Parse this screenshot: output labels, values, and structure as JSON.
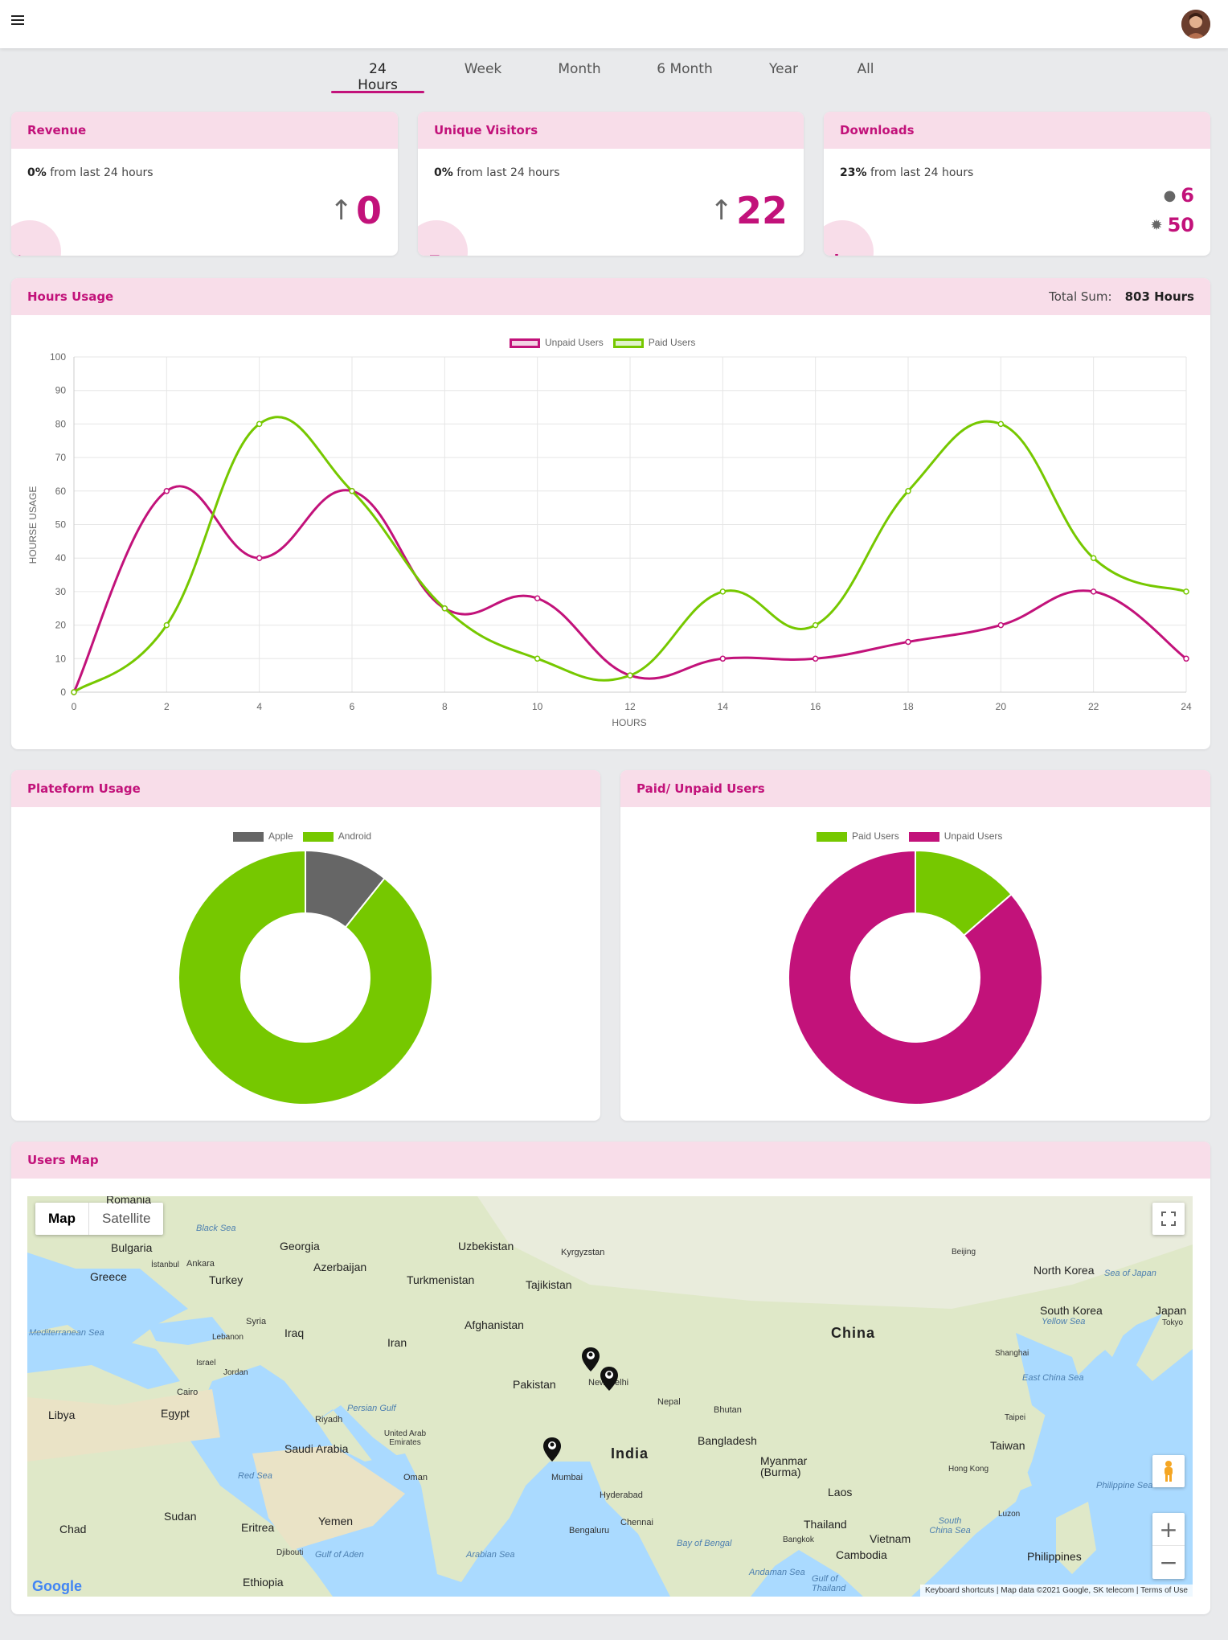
{
  "header": {
    "menu_icon": "hamburger-icon",
    "avatar": "user-avatar"
  },
  "tabs": [
    {
      "label": "24 Hours",
      "active": true
    },
    {
      "label": "Week"
    },
    {
      "label": "Month"
    },
    {
      "label": "6 Month"
    },
    {
      "label": "Year"
    },
    {
      "label": "All"
    }
  ],
  "stats": {
    "revenue": {
      "title": "Revenue",
      "pct": "0%",
      "sub": "from last 24 hours",
      "value": "0",
      "icon": "dollar-icon"
    },
    "visitors": {
      "title": "Unique Visitors",
      "pct": "0%",
      "sub": "from last 24 hours",
      "value": "22",
      "icon": "trend-arrow-icon"
    },
    "downloads": {
      "title": "Downloads",
      "pct": "23%",
      "sub": "from last 24 hours",
      "apple": "6",
      "android": "50",
      "icon": "download-icon"
    }
  },
  "hours_usage": {
    "title": "Hours Usage",
    "total_label": "Total Sum:",
    "total_value": "803 Hours"
  },
  "platform_usage": {
    "title": "Plateform Usage"
  },
  "paid_unpaid": {
    "title": "Paid/ Unpaid Users"
  },
  "users_map": {
    "title": "Users Map",
    "map_button": "Map",
    "satellite_button": "Satellite",
    "footer_shortcuts": "Keyboard shortcuts",
    "footer_data": "Map data ©2021 Google, SK telecom",
    "footer_terms": "Terms of Use",
    "google": "Google",
    "labels": {
      "romania": "Romania",
      "bulgaria": "Bulgaria",
      "greece": "Greece",
      "turkey": "Turkey",
      "ankara": "Ankara",
      "istanbul": "İstanbul",
      "georgia": "Georgia",
      "azerbaijan": "Azerbaijan",
      "uzbekistan": "Uzbekistan",
      "kyrgyzstan": "Kyrgyzstan",
      "turkmenistan": "Turkmenistan",
      "tajikistan": "Tajikistan",
      "syria": "Syria",
      "lebanon": "Lebanon",
      "iraq": "Iraq",
      "iran": "Iran",
      "afghanistan": "Afghanistan",
      "israel": "Israel",
      "jordan": "Jordan",
      "pakistan": "Pakistan",
      "cairo": "Cairo",
      "egypt": "Egypt",
      "libya": "Libya",
      "riyadh": "Riyadh",
      "saudi": "Saudi Arabia",
      "uae": "United Arab Emirates",
      "oman": "Oman",
      "india": "India",
      "nepal": "Nepal",
      "bhutan": "Bhutan",
      "bangladesh": "Bangladesh",
      "myanmar": "Myanmar (Burma)",
      "china": "China",
      "beijing": "Beijing",
      "north_korea": "North Korea",
      "south_korea": "South Korea",
      "japan": "Japan",
      "tokyo": "Tokyo",
      "shanghai": "Shanghai",
      "taipei": "Taipei",
      "taiwan": "Taiwan",
      "hong_kong": "Hong Kong",
      "laos": "Laos",
      "thailand": "Thailand",
      "bangkok": "Bangkok",
      "vietnam": "Vietnam",
      "cambodia": "Cambodia",
      "philippines": "Philippines",
      "luzon": "Luzon",
      "sudan": "Sudan",
      "chad": "Chad",
      "eritrea": "Eritrea",
      "yemen": "Yemen",
      "djibouti": "Djibouti",
      "ethiopia": "Ethiopia",
      "mumbai": "Mumbai",
      "hyderabad": "Hyderabad",
      "bengaluru": "Bengaluru",
      "chennai": "Chennai",
      "new_delhi": "New Delhi",
      "black_sea": "Black Sea",
      "med_sea": "Mediterranean Sea",
      "red_sea": "Red Sea",
      "persian_gulf": "Persian Gulf",
      "arabian_sea": "Arabian Sea",
      "bay_bengal": "Bay of Bengal",
      "andaman": "Andaman Sea",
      "gulf_aden": "Gulf of Aden",
      "sea_japan": "Sea of Japan",
      "yellow_sea": "Yellow Sea",
      "east_china": "East China Sea",
      "south_china": "South China Sea",
      "philippine_sea": "Philippine Sea",
      "gulf_thailand": "Gulf of Thailand"
    }
  },
  "colors": {
    "accent": "#c2127a",
    "accent_light": "#f8dde9",
    "green": "#76c800",
    "gray": "#666666"
  },
  "chart_data": [
    {
      "type": "line",
      "x": [
        0,
        2,
        4,
        6,
        8,
        10,
        12,
        14,
        16,
        18,
        20,
        22,
        24
      ],
      "series": [
        {
          "name": "Unpaid Users",
          "color": "#c2127a",
          "values": [
            0,
            60,
            40,
            60,
            25,
            28,
            5,
            10,
            10,
            15,
            20,
            30,
            10
          ]
        },
        {
          "name": "Paid Users",
          "color": "#76c800",
          "values": [
            0,
            20,
            80,
            60,
            25,
            10,
            5,
            30,
            20,
            60,
            80,
            40,
            30
          ]
        }
      ],
      "xlabel": "HOURS",
      "ylabel": "HOURSE USAGE",
      "xlim": [
        0,
        24
      ],
      "ylim": [
        0,
        100
      ],
      "xticks": [
        0,
        2,
        4,
        6,
        8,
        10,
        12,
        14,
        16,
        18,
        20,
        22,
        24
      ],
      "yticks": [
        0,
        10,
        20,
        30,
        40,
        50,
        60,
        70,
        80,
        90,
        100
      ],
      "grid": true,
      "legend": "top-center"
    },
    {
      "type": "pie",
      "labels": [
        "Apple",
        "Android"
      ],
      "values": [
        6,
        50
      ],
      "colors": [
        "#666666",
        "#76c800"
      ],
      "legend": "top-center"
    },
    {
      "type": "pie",
      "labels": [
        "Paid Users",
        "Unpaid Users"
      ],
      "values": [
        3,
        19
      ],
      "colors": [
        "#76c800",
        "#c2127a"
      ],
      "legend": "top-center"
    }
  ]
}
